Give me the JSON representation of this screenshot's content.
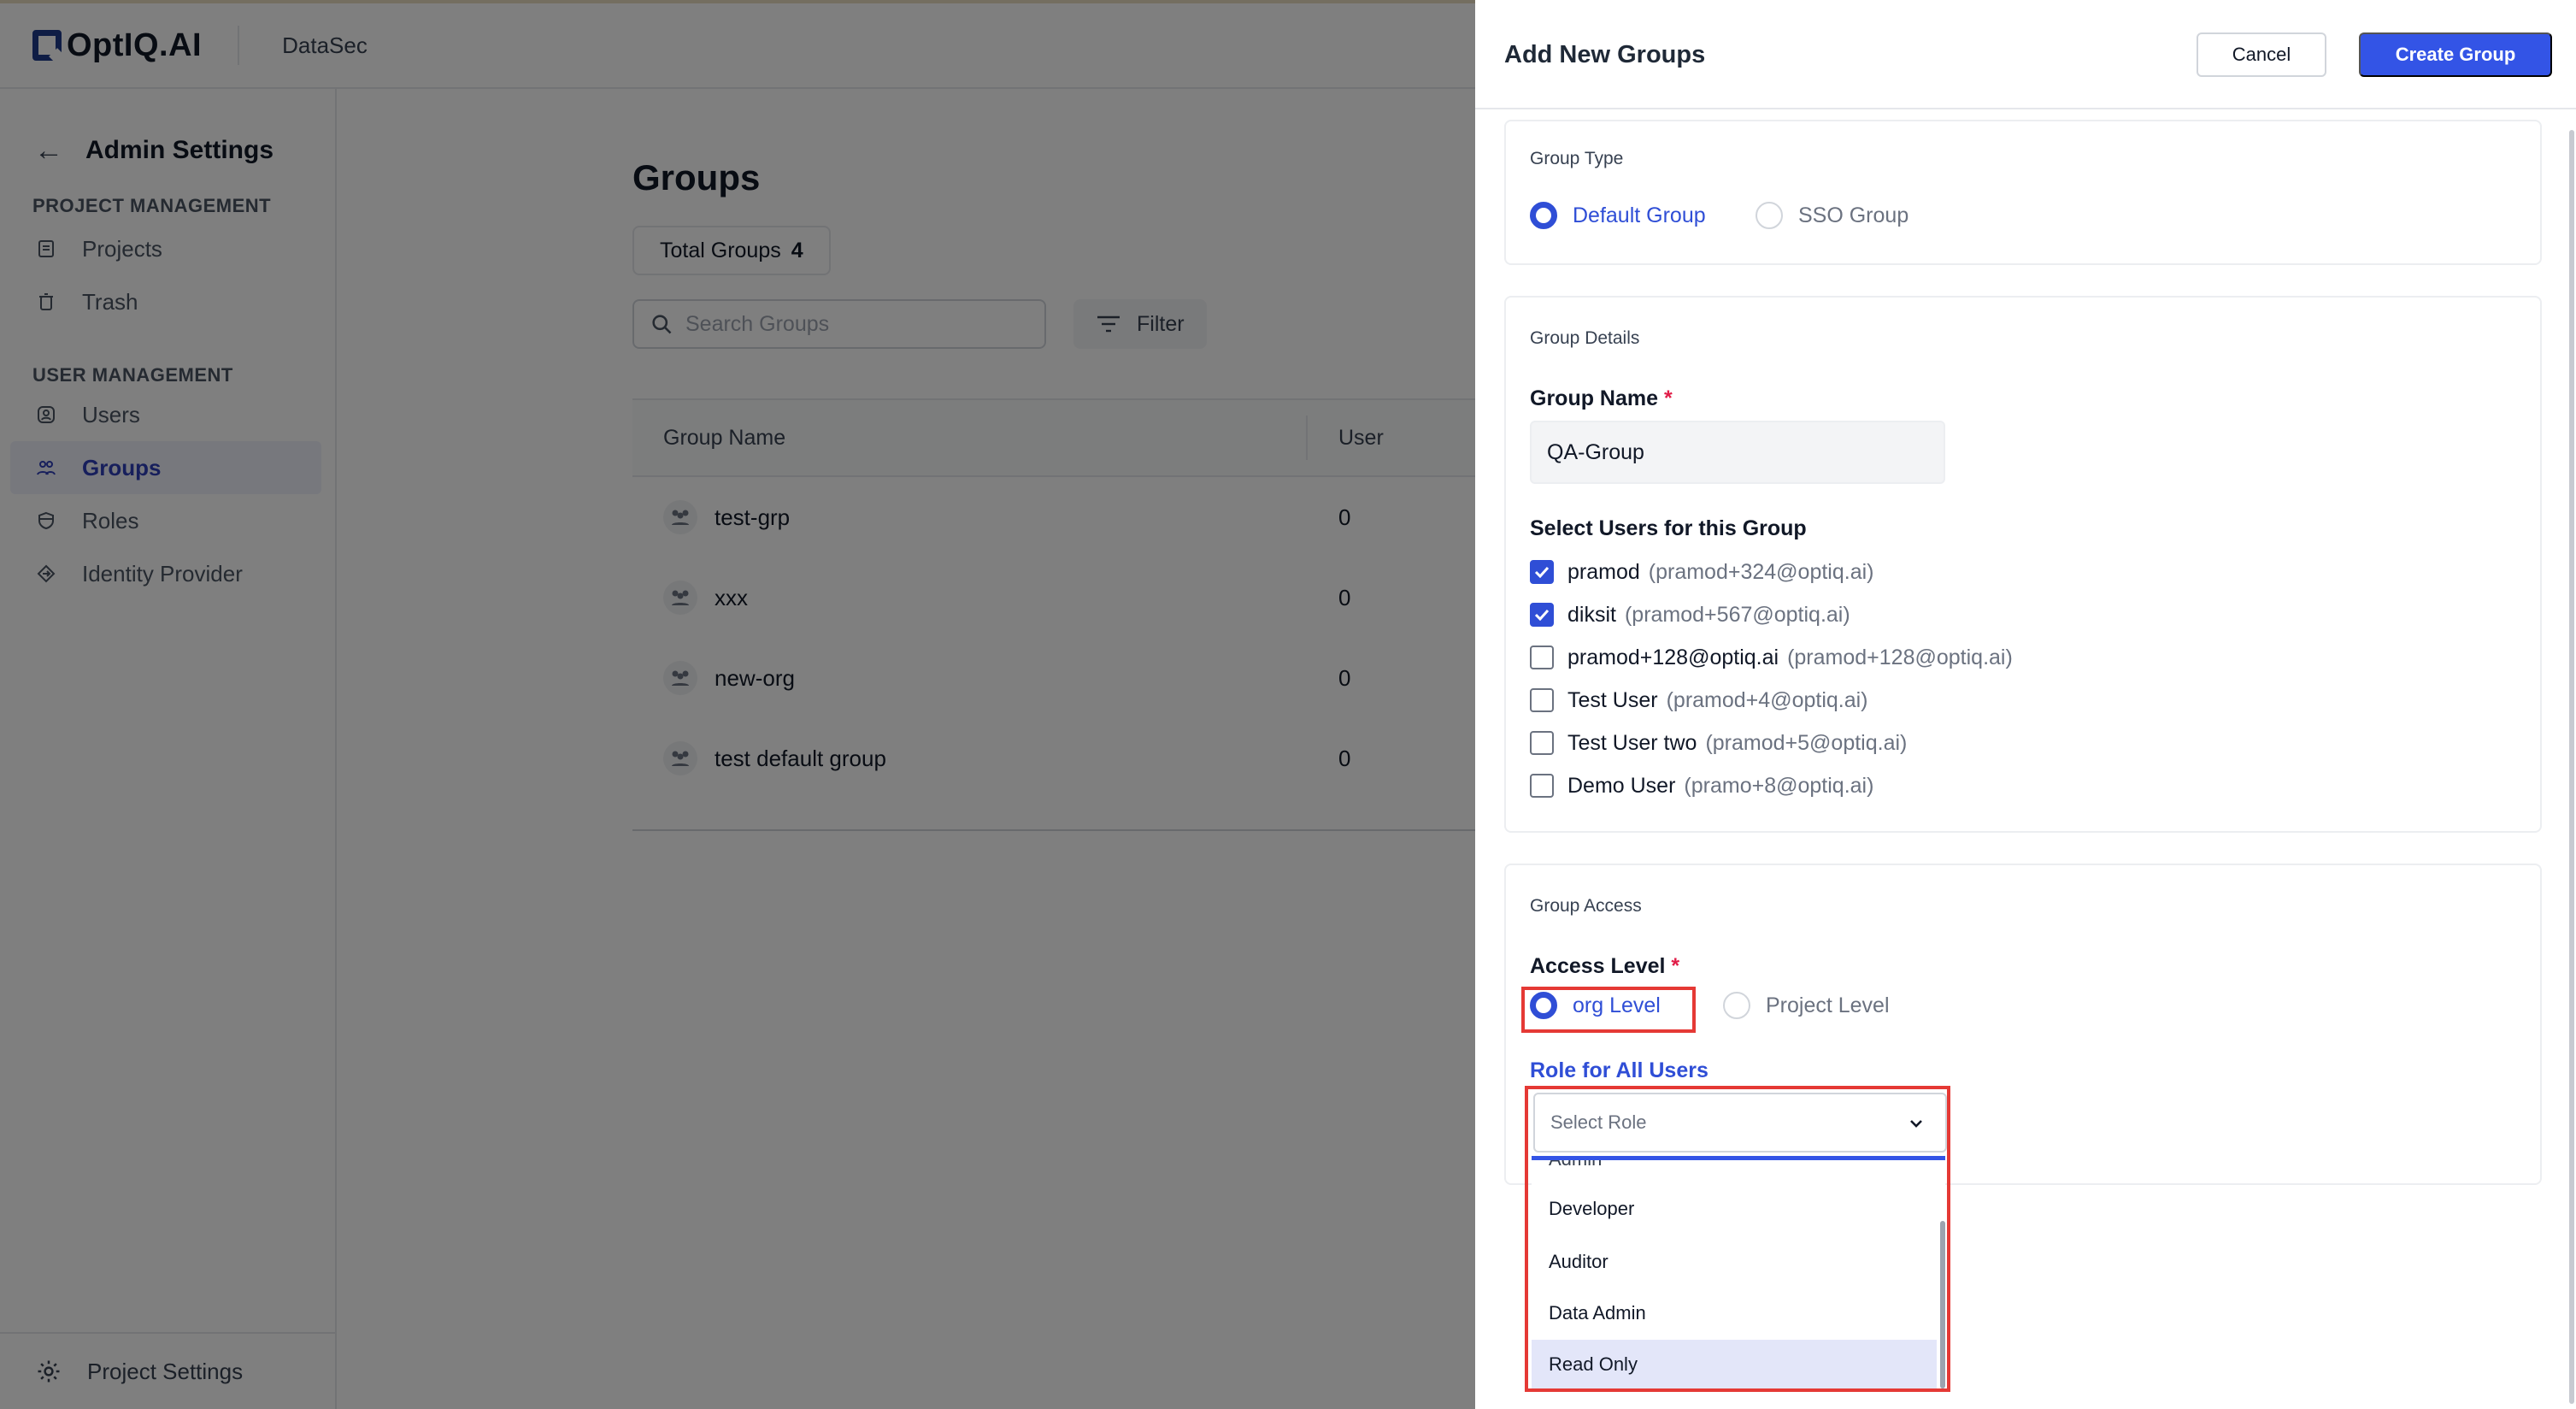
{
  "app": {
    "brand": "OptIQ.AI",
    "product": "DataSec"
  },
  "sidebar": {
    "title": "Admin Settings",
    "sections": [
      {
        "label": "PROJECT MANAGEMENT",
        "items": [
          {
            "label": "Projects",
            "icon": "projects-icon"
          },
          {
            "label": "Trash",
            "icon": "trash-icon"
          }
        ]
      },
      {
        "label": "USER MANAGEMENT",
        "items": [
          {
            "label": "Users",
            "icon": "users-icon"
          },
          {
            "label": "Groups",
            "icon": "groups-icon",
            "active": true
          },
          {
            "label": "Roles",
            "icon": "roles-icon"
          },
          {
            "label": "Identity Provider",
            "icon": "identity-provider-icon"
          }
        ]
      }
    ],
    "footer": "Project Settings"
  },
  "main": {
    "title": "Groups",
    "total_label": "Total Groups",
    "total_count": "4",
    "search_placeholder": "Search Groups",
    "filter_label": "Filter",
    "columns": [
      "Group Name",
      "User"
    ],
    "rows": [
      {
        "name": "test-grp",
        "users": "0"
      },
      {
        "name": "xxx",
        "users": "0"
      },
      {
        "name": "new-org",
        "users": "0"
      },
      {
        "name": "test default group",
        "users": "0"
      }
    ]
  },
  "drawer": {
    "title": "Add New Groups",
    "cancel": "Cancel",
    "create": "Create Group",
    "group_type": {
      "label": "Group Type",
      "options": [
        "Default Group",
        "SSO Group"
      ],
      "selected": "Default Group"
    },
    "group_details": {
      "label": "Group Details",
      "name_label": "Group Name",
      "name_value": "QA-Group",
      "users_label": "Select Users for this Group",
      "users": [
        {
          "name": "pramod",
          "email": "(pramod+324@optiq.ai)",
          "checked": true
        },
        {
          "name": "diksit",
          "email": "(pramod+567@optiq.ai)",
          "checked": true
        },
        {
          "name": "pramod+128@optiq.ai",
          "email": "(pramod+128@optiq.ai)",
          "checked": false
        },
        {
          "name": "Test User",
          "email": "(pramod+4@optiq.ai)",
          "checked": false
        },
        {
          "name": "Test User two",
          "email": "(pramod+5@optiq.ai)",
          "checked": false
        },
        {
          "name": "Demo User",
          "email": "(pramo+8@optiq.ai)",
          "checked": false
        }
      ]
    },
    "group_access": {
      "label": "Group Access",
      "access_label": "Access Level",
      "options": [
        "org Level",
        "Project Level"
      ],
      "selected": "org Level",
      "role_label": "Role for All Users",
      "role_placeholder": "Select Role",
      "role_options": [
        "Admin",
        "Developer",
        "Auditor",
        "Data Admin",
        "Read Only"
      ],
      "highlighted_option": "Read Only"
    }
  },
  "colors": {
    "accent": "#3354e6",
    "highlight": "#e53935",
    "overlay": "rgba(0,0,0,0.5)"
  }
}
